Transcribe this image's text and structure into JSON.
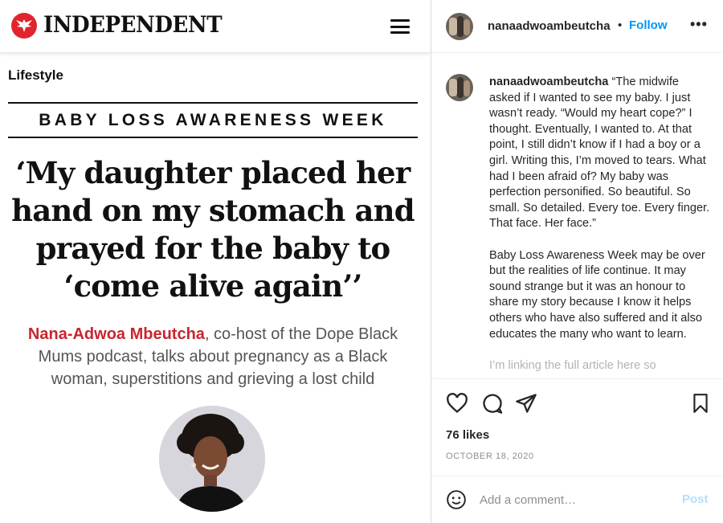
{
  "article": {
    "brand": "INDEPENDENT",
    "section": "Lifestyle",
    "kicker": "BABY LOSS AWARENESS WEEK",
    "headline": "‘My daughter placed her hand on my stomach and prayed for the baby to ‘come alive again’’",
    "standfirst_name": "Nana-Adwoa Mbeutcha",
    "standfirst_rest": ", co-host of the Dope Black Mums podcast, talks about pregnancy as a Black woman, superstitions and grieving a lost child",
    "brand_color": "#e0252e",
    "name_color": "#c8262f"
  },
  "instagram": {
    "username": "nanaadwoambeutcha",
    "separator": "•",
    "follow_label": "Follow",
    "more_label": "•••",
    "caption_user": "nanaadwoambeutcha",
    "caption_p1": "“The midwife asked if I wanted to see my baby. I just wasn’t ready. “Would my heart cope?” I thought. Eventually, I wanted to. At that point, I still didn’t know if I had a boy or a girl. Writing this, I’m moved to tears. What had I been afraid of? My baby was perfection personified. So beautiful. So small. So detailed. Every toe. Every finger. That face. Her face.”",
    "caption_p2": "Baby Loss Awareness Week may be over but the realities of life continue. It may sound strange but it was an honour to share my story because I know it helps others who have also suffered and it also educates the many who want to learn.",
    "caption_p3": "I’m linking the full article here so",
    "likes": "76 likes",
    "date": "OCTOBER 18, 2020",
    "comment_placeholder": "Add a comment…",
    "post_label": "Post",
    "accent": "#0095f6",
    "icons": [
      "heart-icon",
      "comment-icon",
      "share-icon",
      "bookmark-icon",
      "emoji-icon"
    ]
  }
}
